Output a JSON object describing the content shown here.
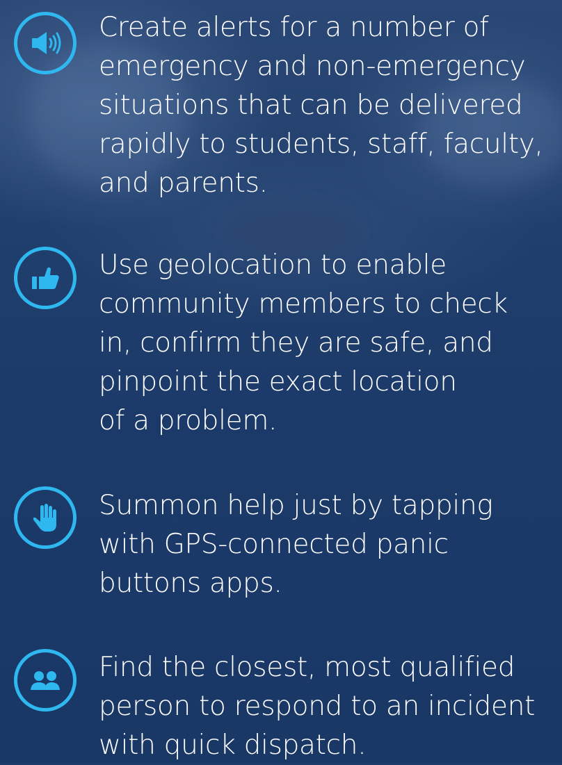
{
  "features": [
    {
      "icon": "megaphone-icon",
      "text": "Create alerts for a number of\nemergency and non-emergency\nsituations that can be delivered\nrapidly to students, staff, faculty,\nand parents."
    },
    {
      "icon": "thumbs-up-icon",
      "text": "Use geolocation to enable\ncommunity members to check\nin, confirm they are safe, and\npinpoint the exact location\nof a problem."
    },
    {
      "icon": "hand-icon",
      "text": "Summon help just by tapping\nwith GPS-connected panic\nbuttons apps."
    },
    {
      "icon": "people-icon",
      "text": "Find the closest, most qualified\nperson to respond to an incident\nwith quick dispatch."
    }
  ],
  "colors": {
    "accent": "#2fb7ef",
    "background": "#1d3b6a",
    "text": "#ffffff"
  }
}
